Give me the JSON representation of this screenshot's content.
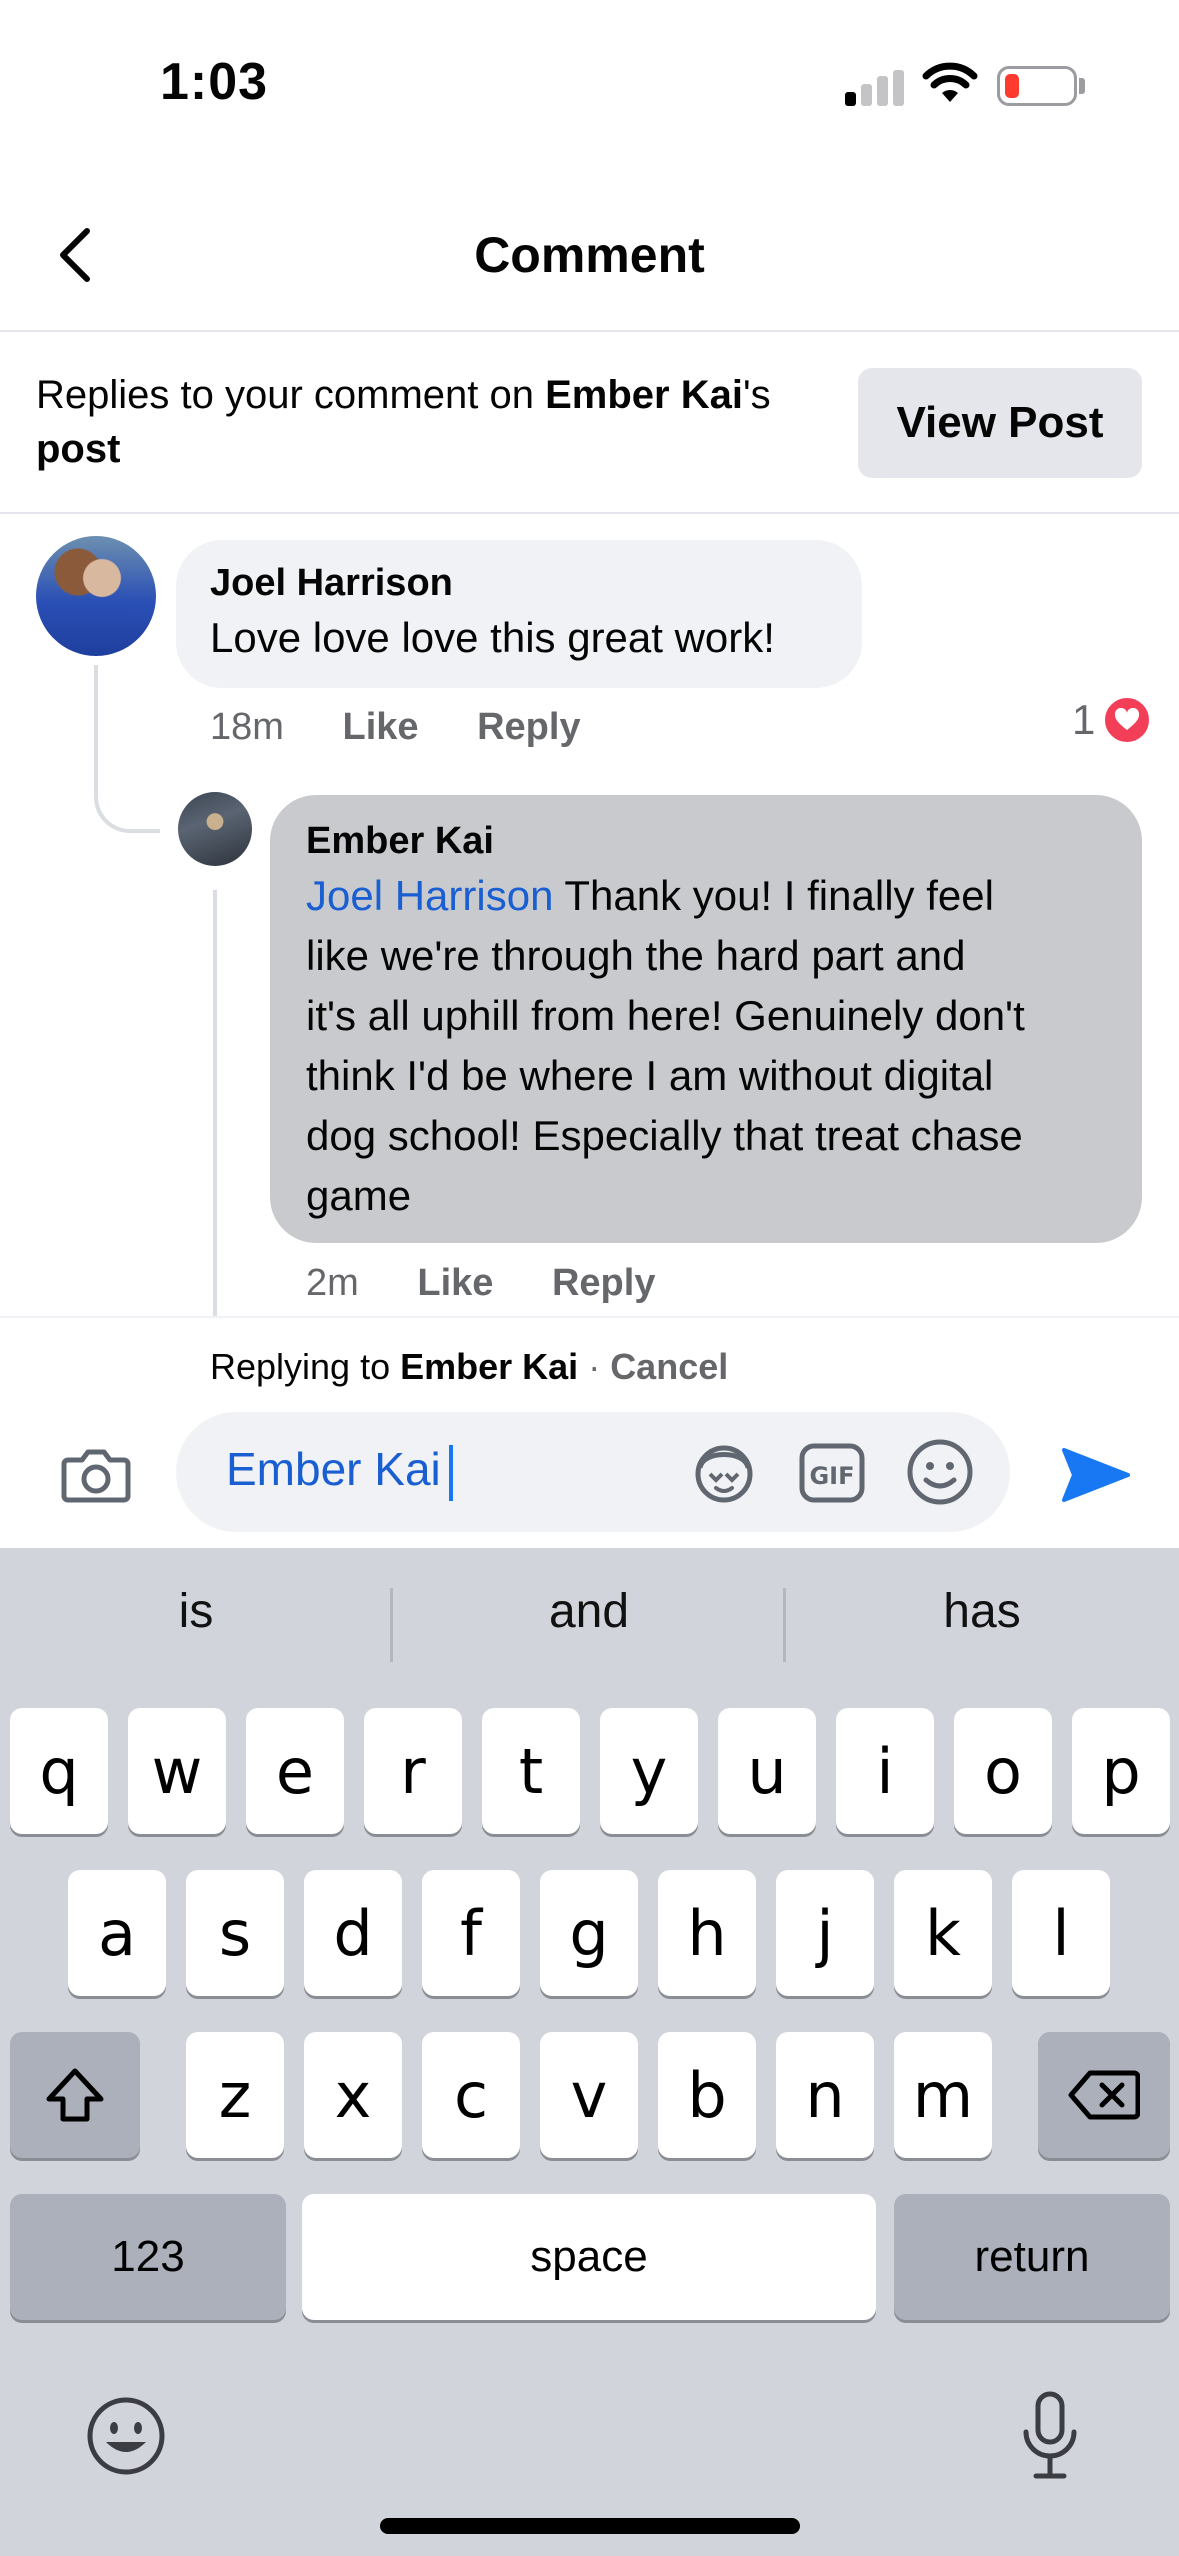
{
  "status": {
    "time": "1:03"
  },
  "header": {
    "title": "Comment"
  },
  "context": {
    "prefix": "Replies to your comment on ",
    "name": "Ember Kai",
    "suffix": "'s",
    "post_word": "post",
    "view_post_label": "View Post"
  },
  "comments": [
    {
      "author": "Joel Harrison",
      "text": "Love love love this great work!",
      "time": "18m",
      "like_label": "Like",
      "reply_label": "Reply",
      "reaction_count": "1"
    },
    {
      "author": "Ember Kai",
      "mention": "Joel Harrison",
      "text_lines": [
        " Thank you! I finally feel",
        "like we're through the hard part and",
        "it's all uphill from here! Genuinely don't",
        "think I'd be where I am without digital",
        "dog school! Especially that treat chase",
        "game"
      ],
      "time": "2m",
      "like_label": "Like",
      "reply_label": "Reply"
    }
  ],
  "replying": {
    "prefix": "Replying to ",
    "name": "Ember Kai",
    "separator": " · ",
    "cancel_label": "Cancel"
  },
  "composer": {
    "value": "Ember Kai"
  },
  "keyboard": {
    "suggestions": [
      "is",
      "and",
      "has"
    ],
    "row1": [
      "q",
      "w",
      "e",
      "r",
      "t",
      "y",
      "u",
      "i",
      "o",
      "p"
    ],
    "row2": [
      "a",
      "s",
      "d",
      "f",
      "g",
      "h",
      "j",
      "k",
      "l"
    ],
    "row3": [
      "z",
      "x",
      "c",
      "v",
      "b",
      "n",
      "m"
    ],
    "numbers_label": "123",
    "space_label": "space",
    "return_label": "return"
  },
  "colors": {
    "mention": "#1a5fd1",
    "send": "#1877f2",
    "heart": "#f33e58",
    "battery_low": "#ff3b30"
  }
}
